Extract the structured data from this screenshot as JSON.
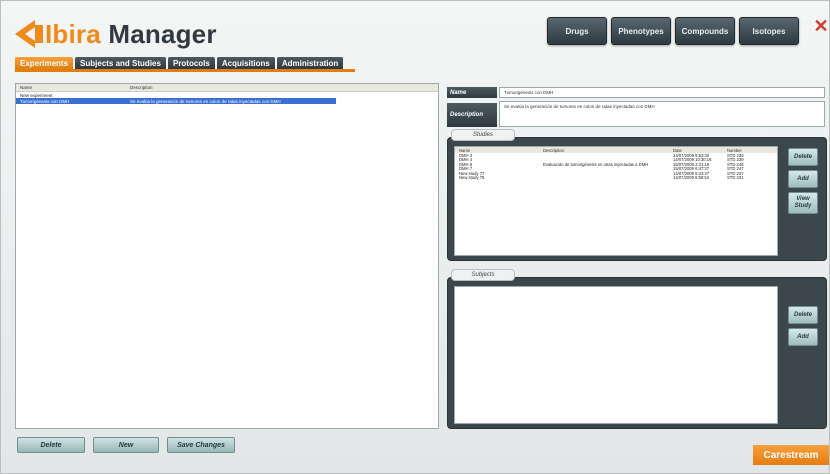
{
  "app": {
    "logo_part1": "Ibira",
    "logo_part2": " Manager",
    "accent_color": "#f08a1a",
    "close_icon": "close-icon"
  },
  "top_buttons": [
    "Drugs",
    "Phenotypes",
    "Compounds",
    "Isotopes"
  ],
  "tabs": [
    "Experiments",
    "Subjects and Studies",
    "Protocols",
    "Acquisitions",
    "Administration"
  ],
  "experiments_list": {
    "headers": [
      "Name",
      "Description"
    ],
    "rows": [
      {
        "name": "New experiment",
        "description": ""
      },
      {
        "name": "Tumorigénesis con DMH",
        "description": "Se evalúa la generación de tumores en colon de ratas inyectadas con DMH"
      }
    ],
    "selected_index": 1
  },
  "bottom_buttons": [
    "Delete",
    "New",
    "Save Changes"
  ],
  "details": {
    "name_label": "Name",
    "name_value": "Tumorigénesis con DMH",
    "description_label": "Description",
    "description_value": "Se evalúa la generación de tumores en colon de ratas inyectadas con DMH"
  },
  "studies": {
    "title": "Studies",
    "headers": [
      "Name",
      "Description",
      "Date",
      "Number"
    ],
    "rows": [
      {
        "name": "DMH 3",
        "description": "",
        "date": "14/07/2009 9:53:30",
        "number": "STD 238"
      },
      {
        "name": "DMH 4",
        "description": "",
        "date": "14/07/2009 10:30:16",
        "number": "STD 239"
      },
      {
        "name": "DMH 6",
        "description": "Evaluación de tumorigénesis en ratas inyectadas a DMH",
        "date": "15/07/2009 2:31:16",
        "number": "STD 246"
      },
      {
        "name": "DMH 7",
        "description": "",
        "date": "15/07/2009 6:47:37",
        "number": "STD 247"
      },
      {
        "name": "New study 77",
        "description": "",
        "date": "14/07/2009 8:23:37",
        "number": "STD 237"
      },
      {
        "name": "New study 78",
        "description": "",
        "date": "14/07/2009 8:58:52",
        "number": "STD 231"
      }
    ],
    "buttons": [
      "Delete",
      "Add",
      "View Study"
    ]
  },
  "subjects": {
    "title": "Subjects",
    "buttons": [
      "Delete",
      "Add"
    ]
  },
  "brand": "Carestream"
}
